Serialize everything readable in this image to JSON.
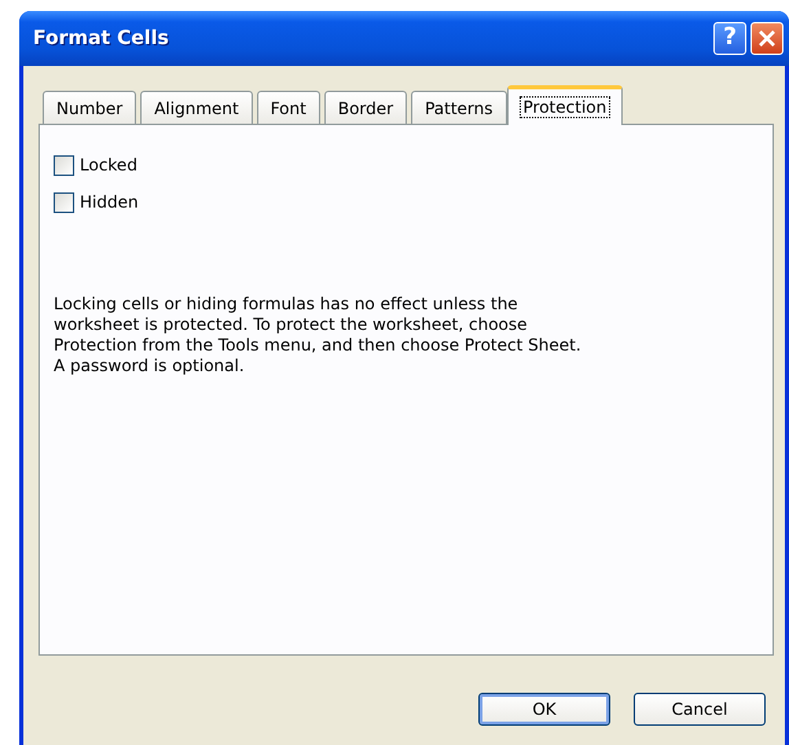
{
  "window": {
    "title": "Format Cells"
  },
  "title_buttons": [
    {
      "kind": "help",
      "label": "?"
    },
    {
      "kind": "close"
    }
  ],
  "tabs": [
    {
      "label": "Number",
      "selected": false
    },
    {
      "label": "Alignment",
      "selected": false
    },
    {
      "label": "Font",
      "selected": false
    },
    {
      "label": "Border",
      "selected": false
    },
    {
      "label": "Patterns",
      "selected": false
    },
    {
      "label": "Protection",
      "selected": true
    }
  ],
  "options": [
    {
      "label": "Locked",
      "checked": false
    },
    {
      "label": "Hidden",
      "checked": false
    }
  ],
  "note": "Locking cells or hiding formulas has no effect unless the worksheet is protected. To protect the worksheet, choose Protection from the Tools menu, and then choose Protect Sheet. A password is optional.",
  "buttons": [
    {
      "label": "OK",
      "default": true
    },
    {
      "label": "Cancel",
      "default": false
    }
  ]
}
